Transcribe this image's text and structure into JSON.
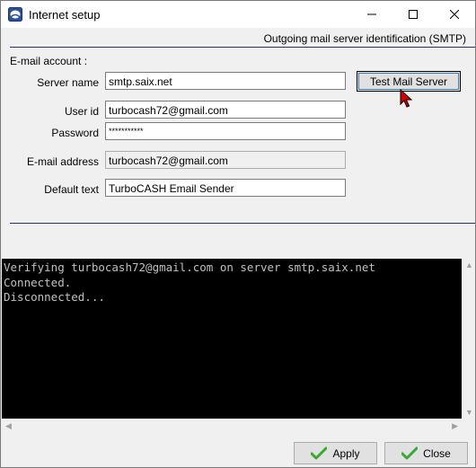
{
  "window": {
    "title": "Internet setup"
  },
  "section": {
    "header": "Outgoing mail server identification (SMTP)",
    "group_label": "E-mail account :"
  },
  "form": {
    "server_name": {
      "label": "Server name",
      "value": "smtp.saix.net"
    },
    "user_id": {
      "label": "User id",
      "value": "turbocash72@gmail.com"
    },
    "password": {
      "label": "Password",
      "value": "***********"
    },
    "email_address": {
      "label": "E-mail address",
      "value": "turbocash72@gmail.com"
    },
    "default_text": {
      "label": "Default text",
      "value": "TurboCASH Email Sender"
    }
  },
  "buttons": {
    "test_mail_server": "Test Mail Server",
    "apply": "Apply",
    "close": "Close"
  },
  "console": {
    "lines": [
      "Verifying turbocash72@gmail.com on server smtp.saix.net",
      "Connected.",
      "Disconnected..."
    ]
  },
  "colors": {
    "rule": "#1f2b6e",
    "check_green": "#3aa832",
    "console_bg": "#000000",
    "console_fg": "#c0c0c0"
  },
  "icons": [
    "app-icon",
    "minimize-icon",
    "maximize-icon",
    "close-icon",
    "mouse-pointer-icon",
    "checkmark-icon"
  ]
}
